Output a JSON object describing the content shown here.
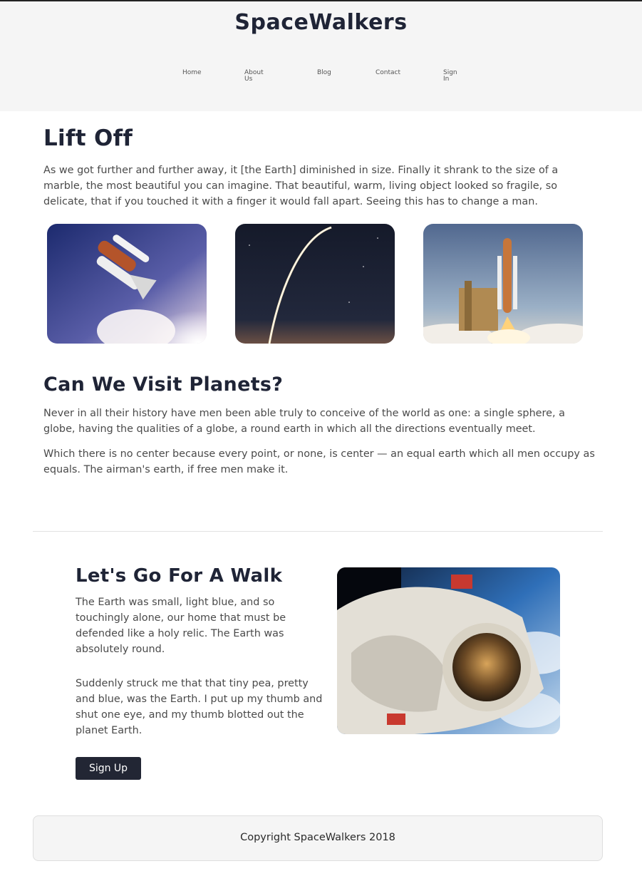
{
  "header": {
    "brand": "SpaceWalkers",
    "nav": [
      {
        "label": "Home"
      },
      {
        "label": "About\nUs"
      },
      {
        "label": "Blog"
      },
      {
        "label": "Contact"
      },
      {
        "label": "Sign\nIn"
      }
    ]
  },
  "lift_off": {
    "title": "Lift Off",
    "body": "As we got further and further away, it [the Earth] diminished in size. Finally it shrank to the size of a marble, the most beautiful you can imagine. That beautiful, warm, living object looked so fragile, so delicate, that if you touched it with a finger it would fall apart. Seeing this has to change a man."
  },
  "gallery": [
    {
      "icon": "space-shuttle-launch-image"
    },
    {
      "icon": "rocket-trail-night-image"
    },
    {
      "icon": "launch-pad-image"
    }
  ],
  "planets": {
    "title": "Can We Visit Planets?",
    "paragraphs": [
      "Never in all their history have men been able truly to conceive of the world as one: a single sphere, a globe, having the qualities of a globe, a round earth in which all the directions eventually meet.",
      "Which there is no center because every point, or none, is center — an equal earth which all men occupy as equals. The airman's earth, if free men make it."
    ]
  },
  "walk": {
    "title": "Let's Go For A Walk",
    "paragraphs": [
      "The Earth was small, light blue, and so touchingly alone, our home that must be defended like a holy relic. The Earth was absolutely round.",
      "Suddenly struck me that that tiny pea, pretty and blue, was the Earth. I put up my thumb and shut one eye, and my thumb blotted out the planet Earth."
    ],
    "button": "Sign Up",
    "image_icon": "astronaut-image"
  },
  "footer": {
    "copyright": "Copyright SpaceWalkers 2018"
  },
  "colors": {
    "heading": "#1f2436",
    "button_bg": "#222634",
    "header_bg": "#f5f5f5",
    "body_text": "#4a4a4a"
  }
}
